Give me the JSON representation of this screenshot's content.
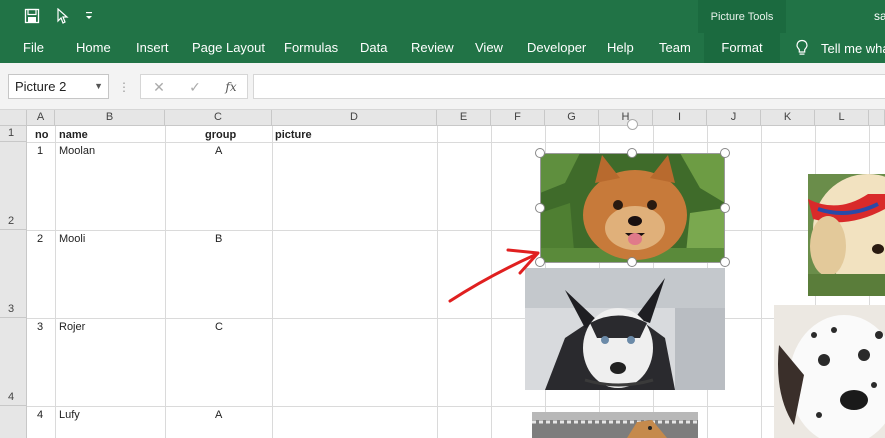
{
  "titlebar": {
    "picture_tools": "Picture Tools",
    "title": "sa",
    "icons": [
      "save-icon",
      "touch-mode-icon",
      "customize-qat-icon"
    ]
  },
  "ribbon": {
    "tabs": [
      "File",
      "Home",
      "Insert",
      "Page Layout",
      "Formulas",
      "Data",
      "Review",
      "View",
      "Developer",
      "Help",
      "Team",
      "Format"
    ],
    "active_tab": "Format",
    "tell_me": "Tell me wha"
  },
  "formula_bar": {
    "name_box": "Picture 2",
    "fx": "fx",
    "value": ""
  },
  "sheet": {
    "columns": [
      "A",
      "B",
      "C",
      "D",
      "E",
      "F",
      "G",
      "H",
      "I",
      "J",
      "K",
      "L"
    ],
    "rows": [
      "1",
      "2",
      "3",
      "4"
    ],
    "headers": {
      "no": "no",
      "name": "name",
      "group": "group",
      "picture": "picture"
    },
    "data": [
      {
        "no": "1",
        "name": "Moolan",
        "group": "A"
      },
      {
        "no": "2",
        "name": "Mooli",
        "group": "B"
      },
      {
        "no": "3",
        "name": "Rojer",
        "group": "C"
      },
      {
        "no": "4",
        "name": "Lufy",
        "group": "A"
      }
    ]
  },
  "colors": {
    "excel_green": "#217346",
    "active_tab": "#1b6a3f",
    "arrow": "#e02020"
  }
}
